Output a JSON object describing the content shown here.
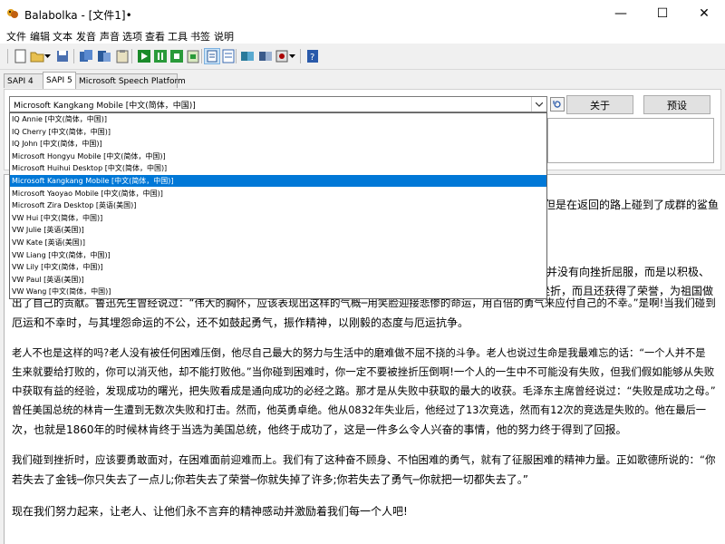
{
  "window": {
    "title": "Balabolka - [文件1]•",
    "minimize_glyph": "—",
    "maximize_glyph": "☐",
    "close_glyph": "✕"
  },
  "menu": [
    "文件",
    "编辑",
    "文本",
    "发音",
    "声音",
    "选项",
    "查看",
    "工具",
    "书签",
    "说明"
  ],
  "toolbar": {
    "icons": [
      "new-file-icon",
      "open-folder-icon",
      "dropdown-arrow-icon",
      "save-icon",
      "export-audio-icon",
      "split-file-icon",
      "open-clipboard-icon",
      "play-icon",
      "pause-icon",
      "stop-icon",
      "read-clipboard-icon",
      "audio-settings-icon",
      "notepad-icon",
      "speak-file-icon",
      "batch-convert-icon",
      "record-icon",
      "dropdown-arrow-icon",
      "help-icon"
    ]
  },
  "tabs": [
    "SAPI 4",
    "SAPI 5",
    "Microsoft Speech Platform"
  ],
  "voice": {
    "selected": "Microsoft Kangkang Mobile [中文(简体，中国)]",
    "about_button": "关于",
    "preset_button": "预设",
    "options": [
      "IQ Annie [中文(简体，中国)]",
      "IQ Cherry [中文(简体，中国)]",
      "IQ John [中文(简体，中国)]",
      "Microsoft Hongyu Mobile [中文(简体，中国)]",
      "Microsoft Huihui Desktop [中文(简体，中国)]",
      "Microsoft Kangkang Mobile [中文(简体，中国)]",
      "Microsoft Yaoyao Mobile [中文(简体，中国)]",
      "Microsoft Zira Desktop [英语(美国)]",
      "VW Hui [中文(简体，中国)]",
      "VW Julie [英语(美国)]",
      "VW Kate [英语(美国)]",
      "VW Liang [中文(简体，中国)]",
      "VW Lily [中文(简体，中国)]",
      "VW Paul [英语(美国)]",
      "VW Wang [中文(简体，中国)]"
    ],
    "selected_index": 5
  },
  "editor_lines": [
    "但是在返回的路上碰到了成群的鲨鱼",
    "他并没有向挫折屈服，而是以积极、",
    "挫折，而且还获得了荣誉，为祖国做",
    "出了自己的贡献。鲁迅先生曾经说过：“伟大的胸怀，应该表现出这样的气概─用笑脸迎接悲惨的命运，用百倍的勇气来应付自己的不幸。”是啊!当我们碰到",
    "厄运和不幸时，与其埋怨命运的不公，还不如鼓起勇气，振作精神，以刚毅的态度与厄运抗争。",
    "",
    "老人不也是这样的吗?老人没有被任何困难压倒，他尽自己最大的努力与生活中的磨难做不屈不挠的斗争。老人也说过生命是我最难忘的话：“一个人并不是",
    "生来就要给打败的，你可以消灭他，却不能打败他。”当你碰到困难时，你一定不要被挫折压倒啊!一个人的一生中不可能没有失败，但我们假如能够从失败",
    "中获取有益的经验，发现成功的曙光，把失败看成是通向成功的必经之路。那才是从失败中获取的最大的收获。毛泽东主席曾经说过：“失败是成功之母。”",
    "曾任美国总统的林肯一生遭到无数次失败和打击。然而，他英勇卓绝。他从0832年失业后，他经过了13次竞选，然而有12次的竞选是失败的。他在最后一",
    "次，也就是1860年的时候林肯终于当选为美国总统，他终于成功了，这是一件多么令人兴奋的事情，他的努力终于得到了回报。",
    "",
    "我们碰到挫折时，应该要勇敢面对，在困难面前迎难而上。我们有了这种奋不顾身、不怕困难的勇气，就有了征服困难的精神力量。正如歌德所说的：“你",
    "若失去了金钱─你只失去了一点儿;你若失去了荣誉─你就失掉了许多;你若失去了勇气─你就把一切都失去了。”",
    "",
    "现在我们努力起来，让老人、让他们永不言弃的精神感动并激励着我们每一个人吧!"
  ],
  "colors": {
    "selection": "#0078d7",
    "window_bg": "#f0f0f0"
  }
}
